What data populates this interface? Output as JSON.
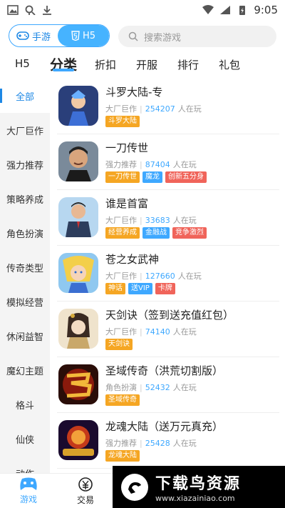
{
  "statusbar": {
    "time": "9:05"
  },
  "toggle": {
    "left_label": "手游",
    "right_label": "H5"
  },
  "search": {
    "placeholder": "搜索游戏"
  },
  "tabs": [
    "H5",
    "分类",
    "折扣",
    "开服",
    "排行",
    "礼包"
  ],
  "sidebar": {
    "items": [
      "全部",
      "大厂巨作",
      "强力推荐",
      "策略养成",
      "角色扮演",
      "传奇类型",
      "模拟经营",
      "休闲益智",
      "魔幻主题",
      "格斗",
      "仙侠",
      "动作"
    ]
  },
  "games": [
    {
      "name": "斗罗大陆-专",
      "category": "大厂巨作",
      "players": "254207",
      "players_suffix": "人在玩",
      "tags": [
        {
          "text": "斗罗大陆",
          "color": "#f5a623"
        }
      ]
    },
    {
      "name": "一刀传世",
      "category": "强力推荐",
      "players": "87404",
      "players_suffix": "人在玩",
      "tags": [
        {
          "text": "一刀传世",
          "color": "#f5a623"
        },
        {
          "text": "魔龙",
          "color": "#3ea8ff"
        },
        {
          "text": "创新五分身",
          "color": "#f0645a"
        }
      ]
    },
    {
      "name": "谁是首富",
      "category": "大厂巨作",
      "players": "33683",
      "players_suffix": "人在玩",
      "tags": [
        {
          "text": "经营养成",
          "color": "#f5a623"
        },
        {
          "text": "金融战",
          "color": "#3ea8ff"
        },
        {
          "text": "竞争激烈",
          "color": "#f0645a"
        }
      ]
    },
    {
      "name": "苍之女武神",
      "category": "大厂巨作",
      "players": "127660",
      "players_suffix": "人在玩",
      "tags": [
        {
          "text": "神话",
          "color": "#f5a623"
        },
        {
          "text": "送VIP",
          "color": "#3ea8ff"
        },
        {
          "text": "卡牌",
          "color": "#f0645a"
        }
      ]
    },
    {
      "name": "天剑诀（签到送充值红包）",
      "category": "大厂巨作",
      "players": "74140",
      "players_suffix": "人在玩",
      "tags": [
        {
          "text": "天剑诀",
          "color": "#f5a623"
        }
      ]
    },
    {
      "name": "圣域传奇（洪荒切割版）",
      "category": "角色扮演",
      "players": "52432",
      "players_suffix": "人在玩",
      "tags": [
        {
          "text": "圣域传奇",
          "color": "#f5a623"
        }
      ]
    },
    {
      "name": "龙魂大陆（送万元真充）",
      "category": "强力推荐",
      "players": "25428",
      "players_suffix": "人在玩",
      "tags": [
        {
          "text": "龙魂大陆",
          "color": "#f5a623"
        }
      ]
    }
  ],
  "bottomnav": {
    "games_label": "游戏",
    "trade_label": "交易"
  },
  "watermark": {
    "title": "下载鸟资源",
    "url": "www.xiazainiao.com"
  },
  "colors": {
    "accent": "#3ea8ff",
    "orange": "#f5a623",
    "red": "#f0645a"
  }
}
